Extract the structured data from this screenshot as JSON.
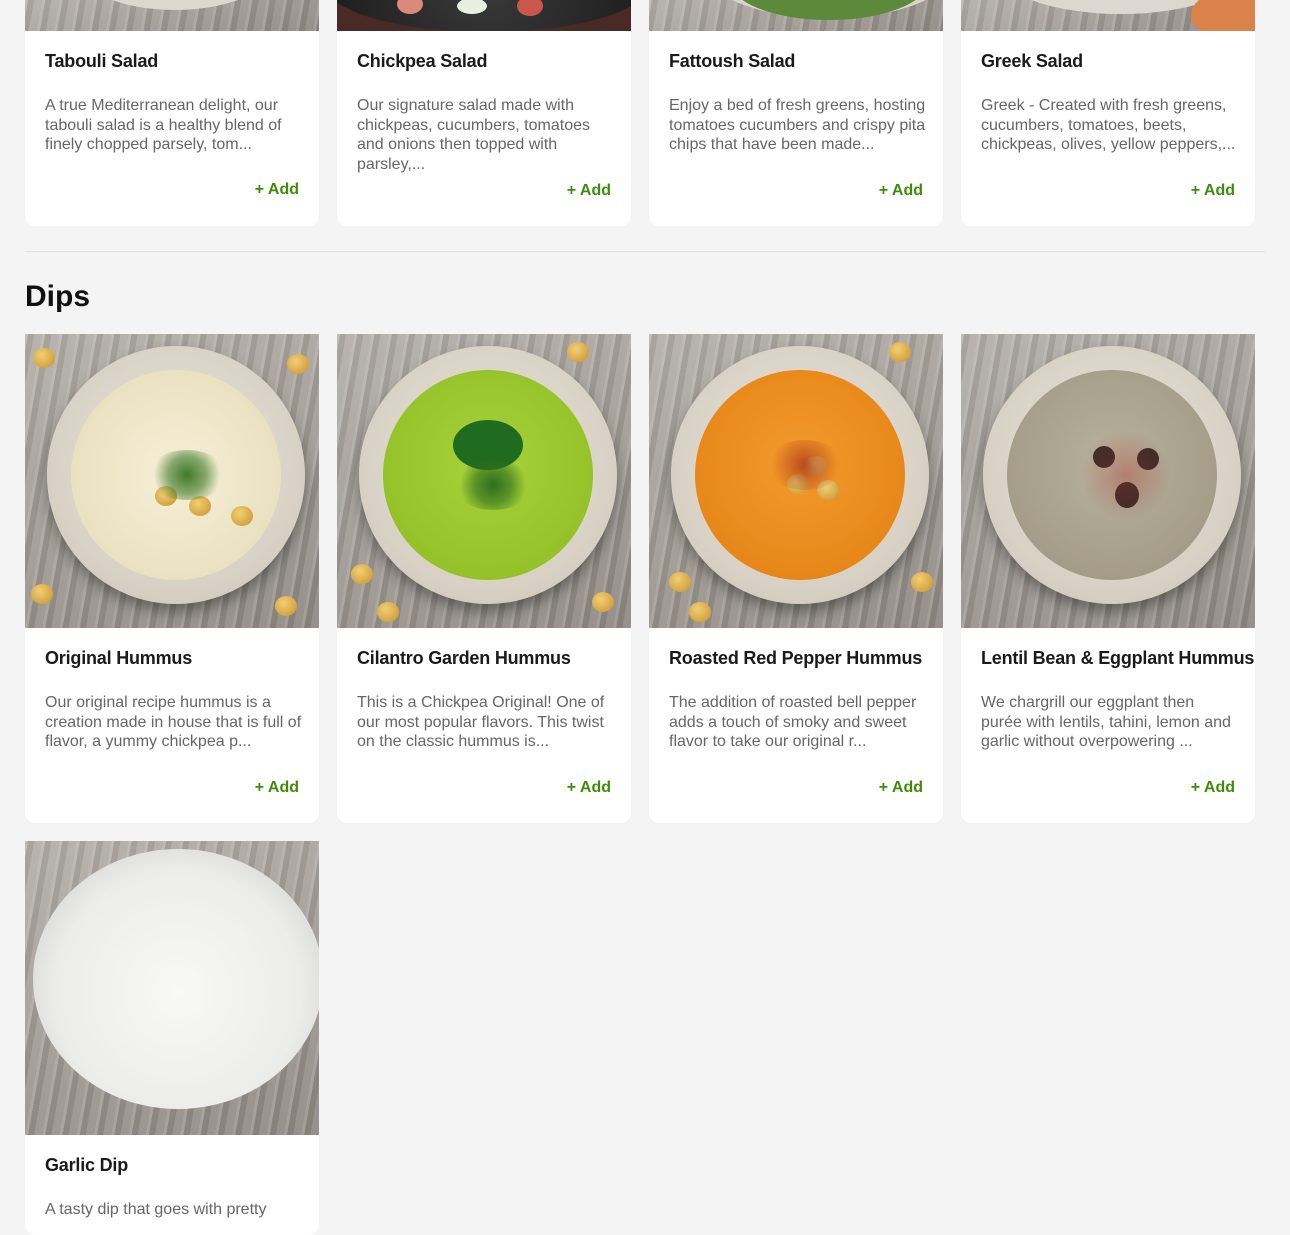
{
  "salads": [
    {
      "title": "Tabouli Salad",
      "desc": "A true Mediterranean delight, our tabouli salad is a healthy blend of finely chopped parsely, tom...",
      "add": "+ Add"
    },
    {
      "title": "Chickpea Salad",
      "desc": "Our signature salad made with chickpeas, cucumbers, tomatoes and onions then topped with parsley,...",
      "add": "+ Add"
    },
    {
      "title": "Fattoush Salad",
      "desc": "Enjoy a bed of fresh greens, hosting tomatoes cucumbers and crispy pita chips that have been made...",
      "add": "+ Add"
    },
    {
      "title": "Greek Salad",
      "desc": "Greek - Created with fresh greens, cucumbers, tomatoes, beets, chickpeas, olives, yellow peppers,...",
      "add": "+ Add"
    }
  ],
  "dips_section": {
    "title": "Dips"
  },
  "dips": [
    {
      "title": "Original Hummus",
      "desc": "Our original recipe hummus is a creation made in house that is full of flavor, a yummy chickpea p...",
      "add": "+ Add"
    },
    {
      "title": "Cilantro Garden Hummus",
      "desc": "This is a Chickpea Original! One of our most popular flavors. This twist on the classic hummus is...",
      "add": "+ Add"
    },
    {
      "title": "Roasted Red Pepper Hummus",
      "desc": "The addition of roasted bell pepper adds a touch of smoky and sweet flavor to take our original r...",
      "add": "+ Add"
    },
    {
      "title": "Lentil Bean & Eggplant Hummus",
      "desc": "We chargrill our eggplant then purée with lentils, tahini, lemon and garlic without overpowering ...",
      "add": "+ Add"
    },
    {
      "title": "Garlic Dip",
      "desc": "A tasty dip that goes with pretty"
    }
  ],
  "colors": {
    "add": "#3f8c0a",
    "background": "#f4f4f4",
    "card": "#ffffff"
  }
}
